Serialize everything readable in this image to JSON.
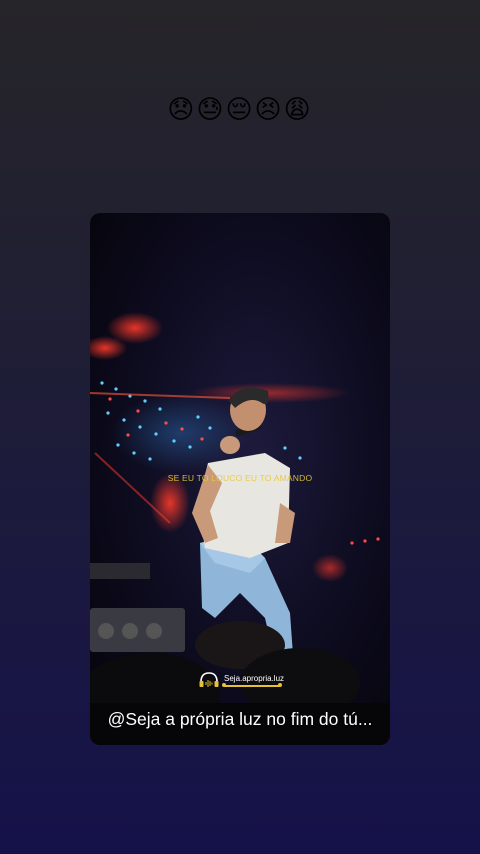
{
  "story": {
    "emojis": "😞😓😔😣😩"
  },
  "post": {
    "lyric_overlay": "SE EU TO LOUCO EU TO AMANDO",
    "watermark_text": "Seja.apropria.luz",
    "caption": "@Seja a própria luz no fim do tú..."
  },
  "colors": {
    "accent_gold": "#e6c233",
    "background_top": "#262529",
    "background_bottom": "#15124a"
  }
}
